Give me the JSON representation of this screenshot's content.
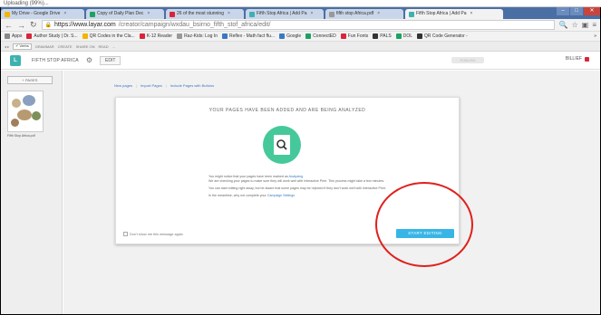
{
  "uploading": "Uploading (99%)...",
  "tabs": [
    {
      "label": "My Drive - Google Drive",
      "color": "#f4b400",
      "active": false
    },
    {
      "label": "Copy of Daily Plan Dec",
      "color": "#1da261",
      "active": false
    },
    {
      "label": "26 of the most stunning",
      "color": "#d9253a",
      "active": false
    },
    {
      "label": "Fifth Stop Africa | Add Pa",
      "color": "#3db2b0",
      "active": false
    },
    {
      "label": "fifth stop Africa.pdf",
      "color": "#999999",
      "active": false
    },
    {
      "label": "Fifth Stop Africa | Add Pa",
      "color": "#3db2b0",
      "active": true
    }
  ],
  "address": {
    "url_host": "https://www.layar.com",
    "url_path": "/creator/campaign/wxdau_bsirno_fifth_stof_africa/edit/"
  },
  "bookmarks": [
    {
      "label": "Apps",
      "color": "#888888"
    },
    {
      "label": "Author Study | Dr. S...",
      "color": "#d9253a"
    },
    {
      "label": "QR Codes in the Cla...",
      "color": "#f4b400"
    },
    {
      "label": "K-12 Reader",
      "color": "#d9253a"
    },
    {
      "label": "Raz-Kids: Log In",
      "color": "#999999"
    },
    {
      "label": "Reflex - Math fact flu...",
      "color": "#3a78c3"
    },
    {
      "label": "Google",
      "color": "#3a78c3"
    },
    {
      "label": "ConnectED",
      "color": "#1da261"
    },
    {
      "label": "Fun Fonts",
      "color": "#d9253a"
    },
    {
      "label": "PALS",
      "color": "#333333"
    },
    {
      "label": "DOL",
      "color": "#1da261"
    },
    {
      "label": "QR Code Generator -",
      "color": "#333333"
    }
  ],
  "bookmarks_more": "»",
  "ext": {
    "verbs": "Verbs",
    "labels": [
      "GRAMMAR",
      "CREATE",
      "SHARE ON",
      "READ",
      "..."
    ]
  },
  "app": {
    "logo": "L",
    "title": "FIFTH STOP AFRICA",
    "edit": "EDIT",
    "publish": "PUBLISH",
    "user": "BILLIEF"
  },
  "sidebar": {
    "add_pages": "+ PAGES",
    "thumb_label": "Fifth Stop Africa.pdf"
  },
  "crumbs": [
    "New pages",
    "Import Pages",
    "Include Pages with Buttons"
  ],
  "modal": {
    "title": "YOUR PAGES HAVE BEEN ADDED AND ARE BEING ANALYZED",
    "p1_a": "You might notice that your pages have been marked as",
    "p1_link": "Analyzing",
    "p1_b": "We are checking your pages to make sure they will work well with Interactive Print. This process might take a few minutes.",
    "p2": "You can start editing right away, but be aware that some pages may be rejected if they don't work well with Interactive Print.",
    "p3_a": "In the meantime, why not complete your",
    "p3_link": "Campaign Settings",
    "dont_show": "Don't show me this message again",
    "start_button": "START EDITING"
  },
  "colors": {
    "accent": "#37b5e6",
    "analyze_circle": "#46c99a",
    "annotation_ring": "#e0201b"
  }
}
